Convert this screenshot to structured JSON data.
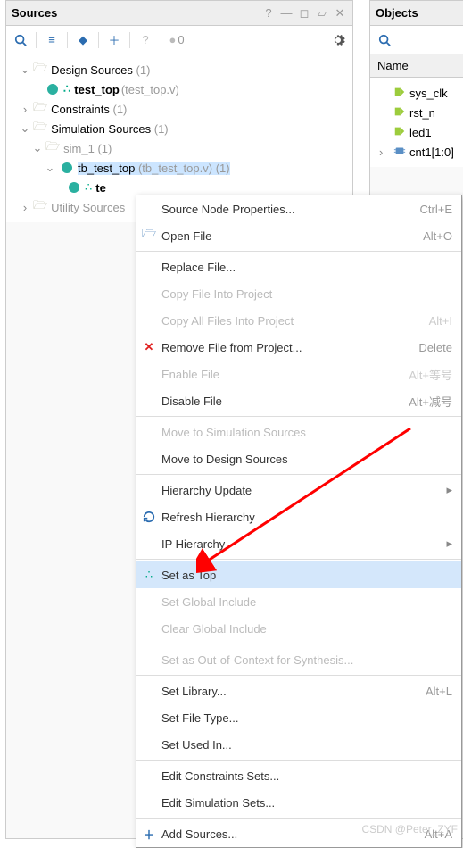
{
  "sources": {
    "title": "Sources",
    "count_badge": "0",
    "tree": {
      "design": {
        "label": "Design Sources",
        "count": "(1)"
      },
      "test_top": {
        "name": "test_top",
        "file": "(test_top.v)"
      },
      "constraints": {
        "label": "Constraints",
        "count": "(1)"
      },
      "sim_sources": {
        "label": "Simulation Sources",
        "count": "(1)"
      },
      "sim1": {
        "label": "sim_1",
        "count": "(1)"
      },
      "tb": {
        "name": "tb_test_top",
        "file": "(tb_test_top.v)",
        "count": "(1)"
      },
      "tchild": {
        "name": "te"
      },
      "utility": {
        "label": "Utility Sources"
      }
    }
  },
  "objects": {
    "title": "Objects",
    "col": "Name",
    "items": [
      {
        "name": "sys_clk",
        "kind": "port"
      },
      {
        "name": "rst_n",
        "kind": "port"
      },
      {
        "name": "led1",
        "kind": "port"
      },
      {
        "name": "cnt1[1:0]",
        "kind": "reg",
        "expand": true
      }
    ]
  },
  "ctx": [
    {
      "label": "Source Node Properties...",
      "sc": "Ctrl+E"
    },
    {
      "label": "Open File",
      "sc": "Alt+O",
      "icon": "open"
    },
    {
      "sep": true
    },
    {
      "label": "Replace File..."
    },
    {
      "label": "Copy File Into Project",
      "disabled": true
    },
    {
      "label": "Copy All Files Into Project",
      "sc": "Alt+I",
      "disabled": true
    },
    {
      "label": "Remove File from Project...",
      "sc": "Delete",
      "icon": "x"
    },
    {
      "label": "Enable File",
      "sc": "Alt+等号",
      "disabled": true
    },
    {
      "label": "Disable File",
      "sc": "Alt+减号"
    },
    {
      "sep": true
    },
    {
      "label": "Move to Simulation Sources",
      "disabled": true
    },
    {
      "label": "Move to Design Sources"
    },
    {
      "sep": true
    },
    {
      "label": "Hierarchy Update",
      "sub": true
    },
    {
      "label": "Refresh Hierarchy",
      "icon": "refresh"
    },
    {
      "label": "IP Hierarchy",
      "sub": true
    },
    {
      "sep": true
    },
    {
      "label": "Set as Top",
      "icon": "top",
      "hover": true
    },
    {
      "label": "Set Global Include",
      "disabled": true
    },
    {
      "label": "Clear Global Include",
      "disabled": true
    },
    {
      "sep": true
    },
    {
      "label": "Set as Out-of-Context for Synthesis...",
      "disabled": true
    },
    {
      "sep": true
    },
    {
      "label": "Set Library...",
      "sc": "Alt+L"
    },
    {
      "label": "Set File Type..."
    },
    {
      "label": "Set Used In..."
    },
    {
      "sep": true
    },
    {
      "label": "Edit Constraints Sets..."
    },
    {
      "label": "Edit Simulation Sets..."
    },
    {
      "sep": true
    },
    {
      "label": "Add Sources...",
      "sc": "Alt+A",
      "icon": "plus"
    }
  ],
  "watermark": "CSDN @Peter_ZYF"
}
